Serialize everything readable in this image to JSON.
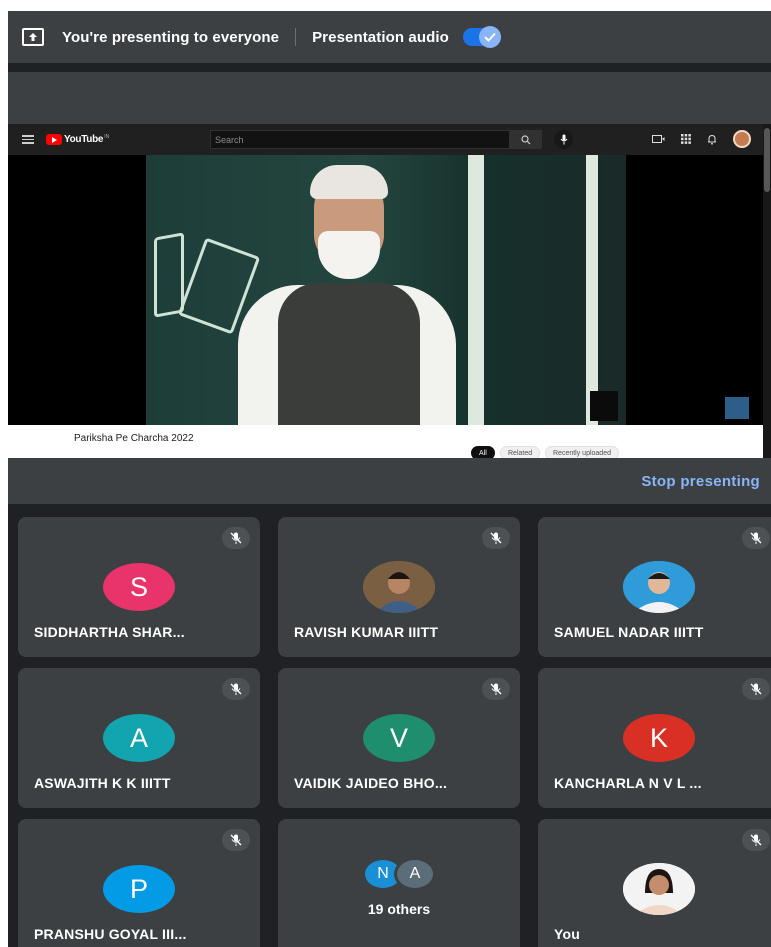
{
  "banner": {
    "message": "You're presenting to everyone",
    "audio_label": "Presentation audio",
    "audio_enabled": true
  },
  "shared_screen": {
    "logo_text": "YouTube",
    "logo_suffix": "IN",
    "search_placeholder": "Search",
    "video_title": "Pariksha Pe Charcha 2022",
    "chips": [
      "All",
      "Related",
      "Recently uploaded"
    ],
    "active_chip": "All"
  },
  "stop_presenting_label": "Stop presenting",
  "participants": [
    {
      "name": "SIDDHARTHA SHAR...",
      "initial": "S",
      "color": "#e8336b",
      "muted": true
    },
    {
      "name": "RAVISH KUMAR IIITT",
      "initial": "",
      "photo": true,
      "muted": true
    },
    {
      "name": "SAMUEL NADAR IIITT",
      "initial": "",
      "photo": true,
      "muted": true
    },
    {
      "name": "ASWAJITH K K IIITT",
      "initial": "A",
      "color": "#12a4af",
      "muted": true
    },
    {
      "name": "VAIDIK JAIDEO BHO...",
      "initial": "V",
      "color": "#1e8e6e",
      "muted": true
    },
    {
      "name": "KANCHARLA N V L ...",
      "initial": "K",
      "color": "#d93025",
      "muted": true
    },
    {
      "name": "PRANSHU GOYAL III...",
      "initial": "P",
      "color": "#039be5",
      "muted": true
    },
    {
      "name": "",
      "others": [
        "N",
        "A"
      ],
      "others_label": "19 others"
    },
    {
      "name": "You",
      "initial": "",
      "photo": true,
      "muted": true
    }
  ]
}
